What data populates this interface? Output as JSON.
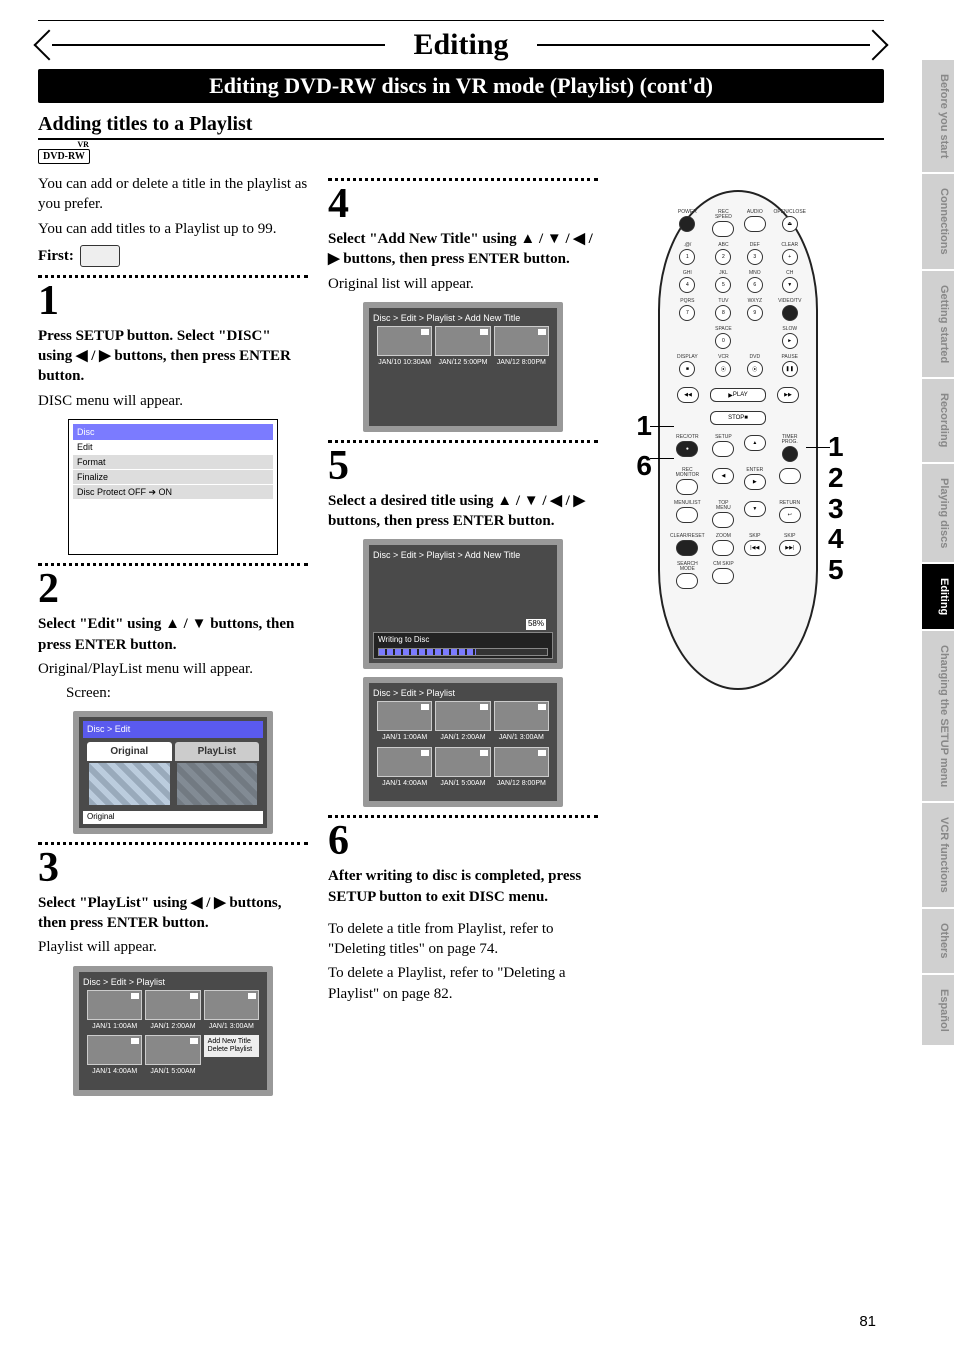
{
  "chapter_title": "Editing",
  "sub_header": "Editing DVD-RW discs in VR mode (Playlist) (cont'd)",
  "section_title": "Adding titles to a Playlist",
  "badge": {
    "text": "DVD-RW",
    "vr": "VR"
  },
  "intro": {
    "p1": "You can add or delete a title in the playlist as you prefer.",
    "p2": "You can add titles to a Playlist up to 99.",
    "first_label": "First:"
  },
  "steps": {
    "s1": {
      "num": "1",
      "head": "Press SETUP button. Select \"DISC\" using ◀ / ▶ buttons, then press ENTER button.",
      "body": "DISC menu will appear."
    },
    "s2": {
      "num": "2",
      "head": "Select \"Edit\" using ▲ / ▼ buttons, then press ENTER button.",
      "body": "Original/PlayList menu will appear.",
      "screen_label": "Screen:"
    },
    "s3": {
      "num": "3",
      "head": "Select \"PlayList\" using ◀ / ▶ buttons, then press ENTER button.",
      "body": "Playlist will appear."
    },
    "s4": {
      "num": "4",
      "head": "Select \"Add New Title\" using ▲ / ▼ / ◀ / ▶ buttons, then press ENTER button.",
      "body": "Original list will appear."
    },
    "s5": {
      "num": "5",
      "head": "Select a desired title using ▲ / ▼ / ◀ / ▶ buttons, then press ENTER button."
    },
    "s6": {
      "num": "6",
      "head": "After writing to disc is completed, press SETUP button to exit DISC menu.",
      "body1": "To delete a title from Playlist, refer to \"Deleting titles\" on page 74.",
      "body2": "To delete a Playlist, refer to \"Deleting a Playlist\" on page 82."
    }
  },
  "osd": {
    "disc_title": "Disc",
    "disc_items": [
      "Edit",
      "Format",
      "Finalize",
      "Disc Protect OFF ➔ ON"
    ],
    "edit_bread": "Disc > Edit",
    "edit_tab_original": "Original",
    "edit_tab_playlist": "PlayList",
    "edit_foot": "Original",
    "playlist_bread": "Disc > Edit > Playlist",
    "addnew_bread": "Disc > Edit > Playlist > Add New Title",
    "writing_label": "Writing to Disc",
    "writing_pct": "58%",
    "thumbs_a": [
      "JAN/1  1:00AM",
      "JAN/1  2:00AM",
      "JAN/1  3:00AM",
      "JAN/1  4:00AM",
      "JAN/1  5:00AM"
    ],
    "add_menu": {
      "l1": "Add New Title",
      "l2": "Delete Playlist"
    },
    "thumbs_b": [
      "JAN/10 10:30AM",
      "JAN/12  5:00PM",
      "JAN/12  8:00PM"
    ],
    "thumbs_c": [
      "JAN/1  1:00AM",
      "JAN/1  2:00AM",
      "JAN/1  3:00AM",
      "JAN/1  4:00AM",
      "JAN/1  5:00AM",
      "JAN/12  8:00PM"
    ]
  },
  "remote": {
    "labels": {
      "power": "POWER",
      "recspeed": "REC SPEED",
      "audio": "AUDIO",
      "openclose": "OPEN/CLOSE",
      "at": ".@/",
      "abc": "ABC",
      "def": "DEF",
      "clr": "CLEAR",
      "ghi": "GHI",
      "jkl": "JKL",
      "mno": "MNO",
      "ch": "CH",
      "pqrs": "PQRS",
      "tuv": "TUV",
      "wxyz": "WXYZ",
      "videotv": "VIDEO/TV",
      "space": "SPACE",
      "slow": "SLOW",
      "display": "DISPLAY",
      "vcr": "VCR",
      "dvd": "DVD",
      "pause": "PAUSE",
      "play": "PLAY",
      "stop": "STOP",
      "recotr": "REC/OTR",
      "setup": "SETUP",
      "timer": "TIMER PROG.",
      "recmon": "REC MONITOR",
      "enter": "ENTER",
      "menulist": "MENU/LIST",
      "topmenu": "TOP MENU",
      "return": "RETURN",
      "clearreset": "CLEAR/RESET",
      "zoom": "ZOOM",
      "skipb": "SKIP",
      "skipf": "SKIP",
      "searchmode": "SEARCH MODE",
      "cmskip": "CM SKIP"
    },
    "nums": {
      "n1": "1",
      "n2": "2",
      "n3": "3",
      "n4": "4",
      "n5": "5",
      "n6": "6",
      "n7": "7",
      "n8": "8",
      "n9": "9",
      "n0": "0"
    }
  },
  "callouts": {
    "l1": "1",
    "l6": "6",
    "r1": "1",
    "r2": "2",
    "r3": "3",
    "r4": "4",
    "r5": "5"
  },
  "tabs": [
    "Before you start",
    "Connections",
    "Getting started",
    "Recording",
    "Playing discs",
    "Editing",
    "Changing the SETUP menu",
    "VCR functions",
    "Others",
    "Español"
  ],
  "active_tab_index": 5,
  "page_number": "81"
}
